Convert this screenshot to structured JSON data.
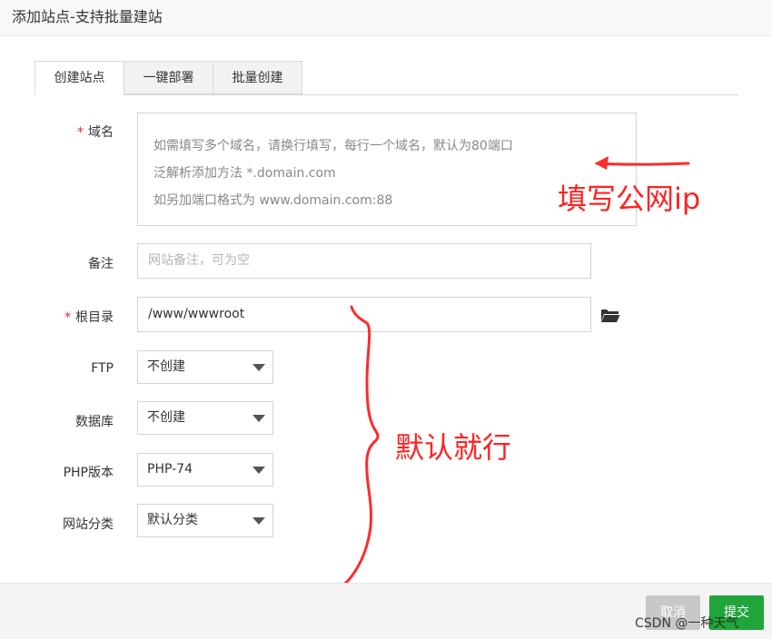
{
  "dialog": {
    "title": "添加站点-支持批量建站"
  },
  "tabs": [
    {
      "label": "创建站点",
      "active": true
    },
    {
      "label": "一键部署",
      "active": false
    },
    {
      "label": "批量创建",
      "active": false
    }
  ],
  "form": {
    "required_mark": "*",
    "domain": {
      "label": "域名",
      "placeholder_lines": [
        "如需填写多个域名，请换行填写，每行一个域名，默认为80端口",
        "泛解析添加方法 *.domain.com",
        "如另加端口格式为 www.domain.com:88"
      ]
    },
    "remark": {
      "label": "备注",
      "placeholder": "网站备注，可为空"
    },
    "root_dir": {
      "label": "根目录",
      "value": "/www/wwwroot",
      "icon": "folder-open-icon"
    },
    "ftp": {
      "label": "FTP",
      "value": "不创建"
    },
    "database": {
      "label": "数据库",
      "value": "不创建"
    },
    "php_version": {
      "label": "PHP版本",
      "value": "PHP-74"
    },
    "site_category": {
      "label": "网站分类",
      "value": "默认分类"
    }
  },
  "buttons": {
    "cancel": "取消",
    "submit": "提交"
  },
  "annotations": {
    "fill_public_ip": "填写公网ip",
    "default_ok": "默认就行",
    "color": "#ff2a2a"
  },
  "watermark": "CSDN @一种天气",
  "colors": {
    "submit_green": "#20a53a",
    "required_red": "#ee2233"
  }
}
